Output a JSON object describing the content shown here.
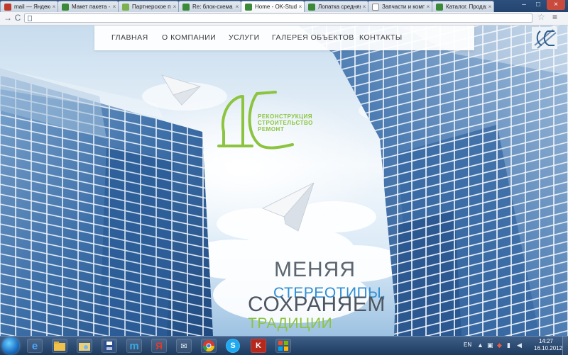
{
  "browser": {
    "tabs": [
      {
        "label": "mail — Яндекс: наш",
        "active": false
      },
      {
        "label": "Макет пакета - allsh",
        "active": false
      },
      {
        "label": "Партнерское предл",
        "active": false
      },
      {
        "label": "Re: блок-схема гла",
        "active": false
      },
      {
        "label": "Home - OK-Studios",
        "active": true
      },
      {
        "label": "Лопатка средняя Р",
        "active": false
      },
      {
        "label": "Запчасти и компле",
        "active": false
      },
      {
        "label": "Каталог. Продажа",
        "active": false
      }
    ],
    "close_glyph": "×",
    "minimize_glyph": "–",
    "maximize_glyph": "□",
    "back_glyph": "→",
    "reload_glyph": "C",
    "star_glyph": "☆",
    "menu_glyph": "≡"
  },
  "site": {
    "nav": [
      {
        "label": "Главная"
      },
      {
        "label": "О компании"
      },
      {
        "label": "Услуги"
      },
      {
        "label": "Галерея объектов"
      },
      {
        "label": "Контакты"
      }
    ],
    "logo_lines": [
      "Реконструкция",
      "Строительство",
      "Ремонт"
    ],
    "tagline": {
      "line1": "Меняя",
      "line2": "стереотипы,",
      "line3": "сохраняем",
      "line4": "традиции"
    },
    "colors": {
      "brand_green": "#8cc43f",
      "accent_blue": "#2f8fd4",
      "text_gray": "#4d5660"
    }
  },
  "taskbar": {
    "icons": [
      {
        "name": "ie-icon",
        "glyph": "e"
      },
      {
        "name": "folder-icon",
        "glyph": ""
      },
      {
        "name": "explorer-icon",
        "glyph": ""
      },
      {
        "name": "floppy-icon",
        "glyph": ""
      },
      {
        "name": "messenger-icon",
        "glyph": "m"
      },
      {
        "name": "yandex-icon",
        "glyph": "Я"
      },
      {
        "name": "mail-icon",
        "glyph": "✉"
      },
      {
        "name": "chrome-icon",
        "glyph": ""
      },
      {
        "name": "skype-icon",
        "glyph": "S"
      },
      {
        "name": "kaspersky-icon",
        "glyph": "K"
      },
      {
        "name": "app-icon",
        "glyph": ""
      }
    ],
    "language": "EN",
    "time": "14:27",
    "date": "16.10.2012"
  }
}
